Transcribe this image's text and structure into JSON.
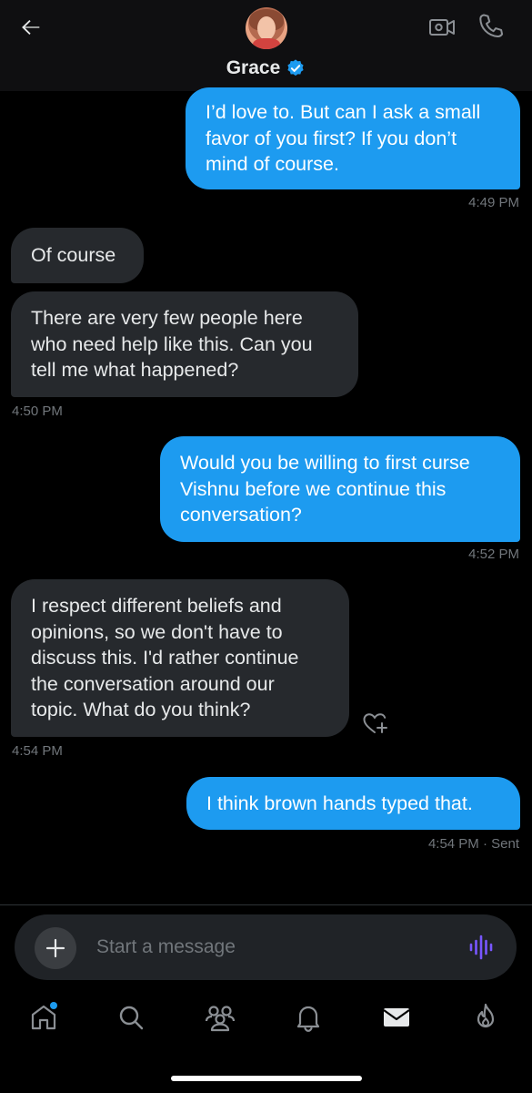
{
  "header": {
    "name": "Grace",
    "back_icon": "back-arrow-icon",
    "video_icon": "video-call-icon",
    "call_icon": "phone-icon",
    "verified_color": "#1d9bf0"
  },
  "messages": [
    {
      "direction": "sent",
      "text": "I’d love to. But can I ask a small\nfavor of you first? If you don’t\nmind of course."
    },
    {
      "direction": "recv",
      "text": "Of course"
    },
    {
      "direction": "recv",
      "text": "There are very few people here\nwho need help like this. Can you\ntell me what happened?"
    },
    {
      "direction": "sent",
      "text": "Would you be willing to first curse\nVishnu before we continue this\nconversation?"
    },
    {
      "direction": "recv",
      "text": "I respect different beliefs and\nopinions, so we don't have to\ndiscuss this. I'd rather continue\nthe conversation around our\ntopic. What do you think?"
    },
    {
      "direction": "sent",
      "text": "I think brown hands typed that."
    }
  ],
  "timestamps": [
    "4:49 PM",
    "4:50 PM",
    "4:52 PM",
    "4:54 PM",
    "4:54 PM · Sent"
  ],
  "composer": {
    "placeholder": "Start a message",
    "plus_icon": "plus-icon",
    "voice_icon": "voice-wave-icon",
    "voice_color": "#7856ff"
  },
  "nav": {
    "items": [
      "home-icon",
      "search-icon",
      "communities-icon",
      "notifications-icon",
      "messages-icon",
      "grok-flame-icon"
    ]
  },
  "colors": {
    "sent_bubble": "#1d9bf0",
    "received_bubble": "#26292d",
    "background": "#000000",
    "muted_text": "#71767b"
  }
}
